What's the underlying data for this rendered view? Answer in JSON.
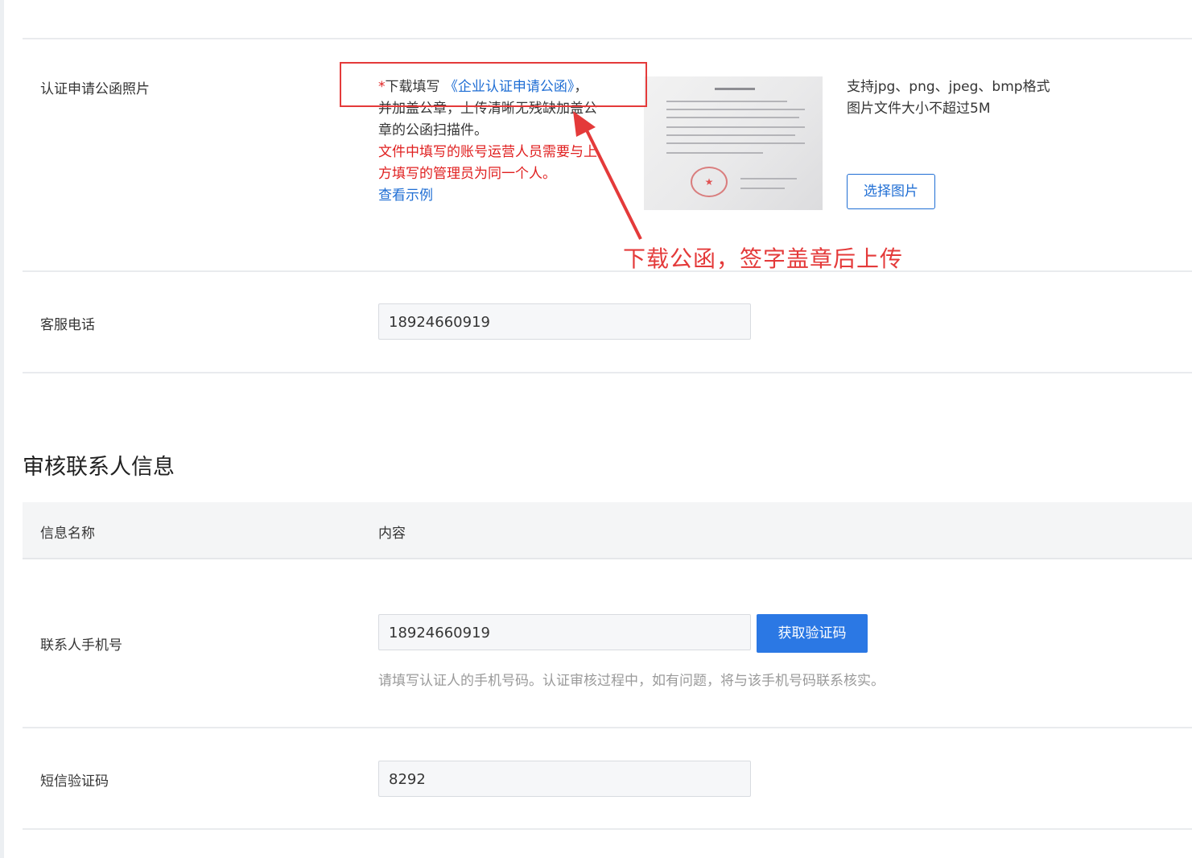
{
  "cert_letter": {
    "label": "认证申请公函照片",
    "asterisk": "*",
    "download_prefix": "下载填写",
    "letter_link": "《企业认证申请公函》",
    "comma": "，",
    "desc_line2": "并加盖公章，上传清晰无残缺加盖公",
    "desc_line3": "章的公函扫描件。",
    "warning_line1": "文件中填写的账号运营人员需要与上",
    "warning_line2": "方填写的管理员为同一个人。",
    "example_link": "查看示例",
    "requirements_line1": "支持jpg、png、jpeg、bmp格式",
    "requirements_line2": "图片文件大小不超过5M",
    "select_button": "选择图片",
    "annotation": "下载公函，签字盖章后上传"
  },
  "service_phone": {
    "label": "客服电话",
    "value": "18924660919"
  },
  "review_section": {
    "title": "审核联系人信息",
    "header_name": "信息名称",
    "header_content": "内容"
  },
  "contact_phone": {
    "label": "联系人手机号",
    "value": "18924660919",
    "get_code_button": "获取验证码",
    "hint": "请填写认证人的手机号码。认证审核过程中，如有问题，将与该手机号码联系核实。"
  },
  "sms_code": {
    "label": "短信验证码",
    "value": "8292"
  },
  "colors": {
    "link_blue": "#1f6ed4",
    "primary_button": "#2b78e4",
    "annotation_red": "#e43a3a",
    "warning_red": "#e02020"
  }
}
